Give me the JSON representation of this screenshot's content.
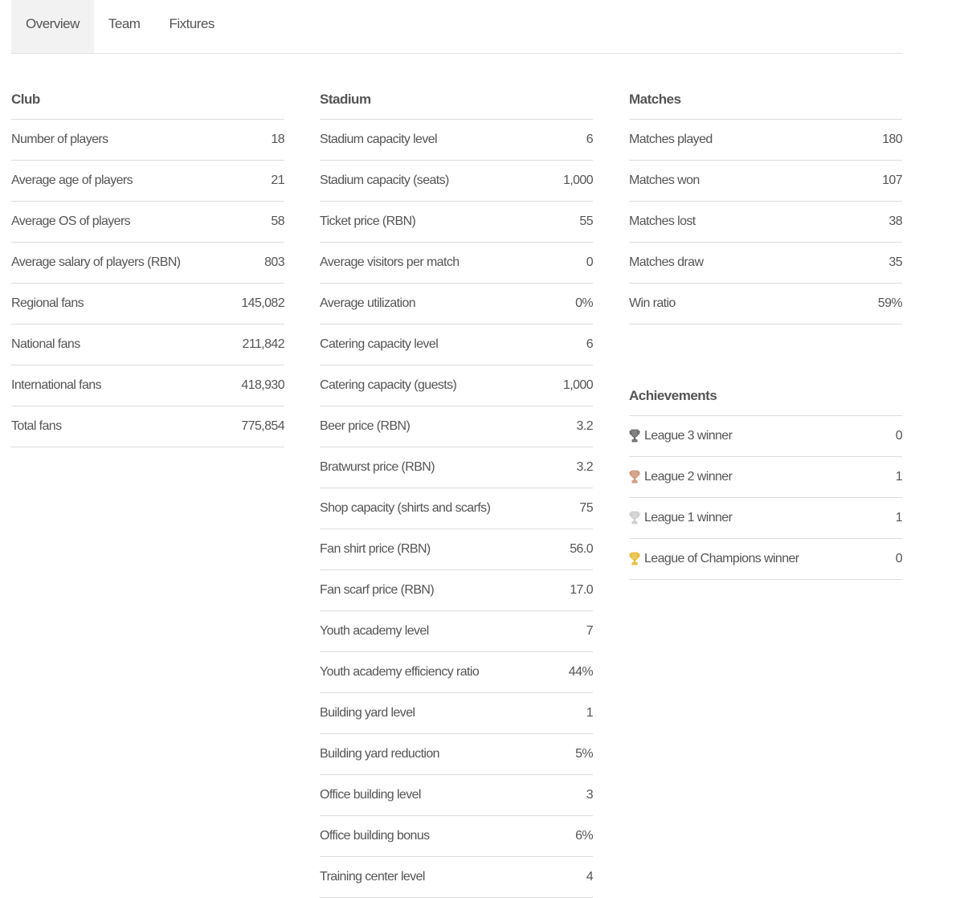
{
  "tabs": [
    {
      "label": "Overview",
      "active": true
    },
    {
      "label": "Team",
      "active": false
    },
    {
      "label": "Fixtures",
      "active": false
    }
  ],
  "club": {
    "title": "Club",
    "rows": [
      {
        "label": "Number of players",
        "value": "18"
      },
      {
        "label": "Average age of players",
        "value": "21"
      },
      {
        "label": "Average OS of players",
        "value": "58"
      },
      {
        "label": "Average salary of players (RBN)",
        "value": "803"
      },
      {
        "label": "Regional fans",
        "value": "145,082"
      },
      {
        "label": "National fans",
        "value": "211,842"
      },
      {
        "label": "International fans",
        "value": "418,930"
      },
      {
        "label": "Total fans",
        "value": "775,854"
      }
    ]
  },
  "stadium": {
    "title": "Stadium",
    "rows": [
      {
        "label": "Stadium capacity level",
        "value": "6"
      },
      {
        "label": "Stadium capacity (seats)",
        "value": "1,000"
      },
      {
        "label": "Ticket price (RBN)",
        "value": "55"
      },
      {
        "label": "Average visitors per match",
        "value": "0"
      },
      {
        "label": "Average utilization",
        "value": "0%"
      },
      {
        "label": "Catering capacity level",
        "value": "6"
      },
      {
        "label": "Catering capacity (guests)",
        "value": "1,000"
      },
      {
        "label": "Beer price (RBN)",
        "value": "3.2"
      },
      {
        "label": "Bratwurst price (RBN)",
        "value": "3.2"
      },
      {
        "label": "Shop capacity (shirts and scarfs)",
        "value": "75"
      },
      {
        "label": "Fan shirt price (RBN)",
        "value": "56.0"
      },
      {
        "label": "Fan scarf price (RBN)",
        "value": "17.0"
      },
      {
        "label": "Youth academy level",
        "value": "7"
      },
      {
        "label": "Youth academy efficiency ratio",
        "value": "44%"
      },
      {
        "label": "Building yard level",
        "value": "1"
      },
      {
        "label": "Building yard reduction",
        "value": "5%"
      },
      {
        "label": "Office building level",
        "value": "3"
      },
      {
        "label": "Office building bonus",
        "value": "6%"
      },
      {
        "label": "Training center level",
        "value": "4"
      }
    ]
  },
  "matches": {
    "title": "Matches",
    "rows": [
      {
        "label": "Matches played",
        "value": "180"
      },
      {
        "label": "Matches won",
        "value": "107"
      },
      {
        "label": "Matches lost",
        "value": "38"
      },
      {
        "label": "Matches draw",
        "value": "35"
      },
      {
        "label": "Win ratio",
        "value": "59%"
      }
    ]
  },
  "achievements": {
    "title": "Achievements",
    "rows": [
      {
        "label": "League 3 winner",
        "value": "0",
        "icon": "trophy-icon",
        "color": "#5a5a5a"
      },
      {
        "label": "League 2 winner",
        "value": "1",
        "icon": "trophy-icon",
        "color": "#c98a6a"
      },
      {
        "label": "League 1 winner",
        "value": "1",
        "icon": "trophy-icon",
        "color": "#c8c8c8"
      },
      {
        "label": "League of Champions winner",
        "value": "0",
        "icon": "trophy-icon",
        "color": "#e6b422"
      }
    ]
  }
}
